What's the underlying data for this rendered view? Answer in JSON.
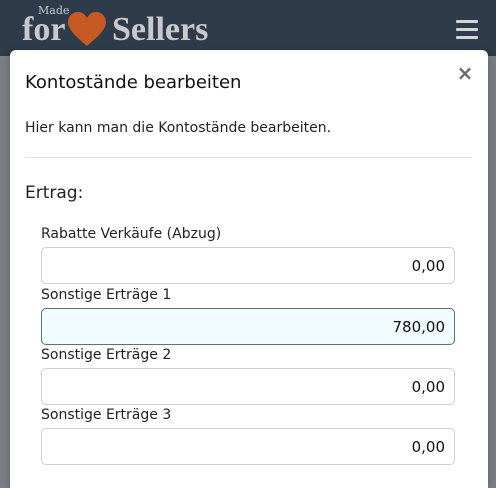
{
  "header": {
    "logo": {
      "made": "Made",
      "for": "for",
      "sellers": "Sellers",
      "heart_color": "#c75a24"
    },
    "menu_icon": "hamburger-menu-icon"
  },
  "modal": {
    "title": "Kontostände bearbeiten",
    "close_icon": "close-icon",
    "close_label": "×",
    "description": "Hier kann man die Kontostände bearbeiten.",
    "section": "Ertrag:",
    "fields": [
      {
        "label": "Rabatte Verkäufe (Abzug)",
        "value": "0,00"
      },
      {
        "label": "Sonstige Erträge 1",
        "value": "780,00"
      },
      {
        "label": "Sonstige Erträge 2",
        "value": "0,00"
      },
      {
        "label": "Sonstige Erträge 3",
        "value": "0,00"
      }
    ]
  },
  "colors": {
    "header_bg": "#2e3b4a",
    "focused_input_bg": "#f0fcfd"
  }
}
